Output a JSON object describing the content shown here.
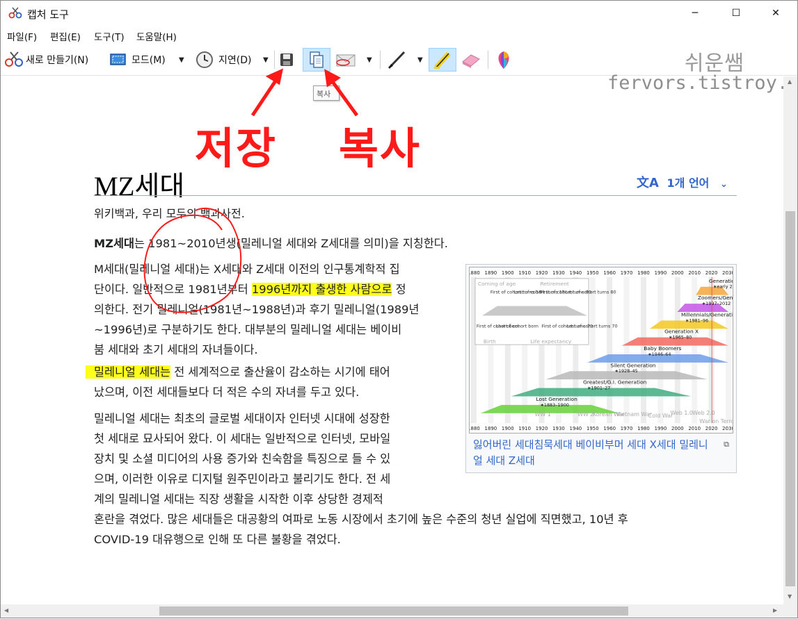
{
  "window": {
    "title": "캡처 도구",
    "controls": {
      "minimize": "─",
      "maximize": "☐",
      "close": "✕"
    }
  },
  "menu": [
    "파일(F)",
    "편집(E)",
    "도구(T)",
    "도움말(H)"
  ],
  "toolbar": {
    "new_label": "새로 만들기(N)",
    "mode_label": "모드(M)",
    "delay_label": "지연(D)",
    "tooltip": "복사",
    "watermark_ko": "쉬운쌤",
    "watermark_url": "fervors.tistroy.co"
  },
  "annotations": {
    "save": "저장",
    "copy": "복사"
  },
  "article": {
    "title": "MZ세대",
    "language_button": "1개 언어",
    "subtitle": "위키백과, 우리 모두의 백과사전.",
    "intro": {
      "bold": "MZ세대",
      "rest": "는 1981~2010년생(밀레니얼 세대와 Z세대를 의미)을 지칭한다."
    },
    "p1": [
      "M세대(밀레니얼 세대)는 X세대와 Z세대 이전의 인구통계학적 집",
      "단이다. 일반적으로 1981년부터 ",
      "1996년까지 출생한 사람으로",
      " 정",
      "의한다. 전기 밀레니얼(1981년~1988년)과 후기 밀레니얼(1989년",
      "~1996년)로 구분하기도 한다. 대부분의 밀레니얼 세대는 베이비",
      "붐 세대와 초기 세대의 자녀들이다."
    ],
    "p2": [
      "밀레니얼 세대는",
      " 전 세계적으로 출산율이 감소하는 시기에 태어",
      "났으며, 이전 세대들보다 더 적은 수의 자녀를 두고 있다."
    ],
    "p3": [
      "밀레니얼 세대는 최초의 글로벌 세대이자 인터넷 시대에 성장한",
      "첫 세대로 묘사되어 왔다. 이 세대는 일반적으로 인터넷, 모바일",
      "장치 및 소셜 미디어의 사용 증가와 친숙함을 특징으로 들 수 있",
      "으며, 이러한 이유로 디지털 원주민이라고 불리기도 한다. 전 세",
      "계의 밀레니얼 세대는 직장 생활을 시작한 이후 상당한 경제적",
      "혼란을 겪었다. 많은 세대들은 대공황의 여파로 노동 시장에서 초기에 높은 수준의 청년 실업에 직면했고, 10년 후",
      "COVID-19 대유행으로 인해 또 다른 불황을 겪었다."
    ],
    "caption": "잃어버린 세대침묵세대 베이비부머 세대 X세대 밀레니얼 세대 Z세대",
    "enlarge_icon": "⧉"
  },
  "chart": {
    "years": [
      "1880",
      "1890",
      "1900",
      "1910",
      "1920",
      "1930",
      "1940",
      "1950",
      "1960",
      "1970",
      "1980",
      "1990",
      "2000",
      "2010",
      "2020",
      "2030"
    ],
    "generations": [
      {
        "name": "Generation Alpha",
        "dates": "∗early 2010s – mid-2020s",
        "color": "#f4a63a"
      },
      {
        "name": "Zoomers/Generation Z",
        "dates": "∗1997–2012",
        "color": "#c455e8"
      },
      {
        "name": "Millennials/Generation Y",
        "dates": "∗1981–96",
        "color": "#f3c81e"
      },
      {
        "name": "Generation X",
        "dates": "∗1965–80",
        "color": "#f2695e"
      },
      {
        "name": "Baby Boomers",
        "dates": "∗1946–64",
        "color": "#6c9ee8"
      },
      {
        "name": "Silent Generation",
        "dates": "∗1928–45",
        "color": "#b8b8b8"
      },
      {
        "name": "Greatest/G.I. Generation",
        "dates": "∗1901–27",
        "color": "#3fae80"
      },
      {
        "name": "Lost Generation",
        "dates": "∗1883–1900",
        "color": "#67d13a"
      }
    ],
    "legend": {
      "coming_of_age": "Coming of age",
      "retirement": "Retirement",
      "first_cohort_18": "First of cohort turns 18",
      "last_cohort_18": "Last of cohort turns 18",
      "first_cohort_80": "First of cohort turns 80",
      "last_cohort_80": "Last of cohort turns 80",
      "first_cohort_born": "First of cohort born",
      "last_cohort_born": "Last of cohort born",
      "first_cohort_70": "First of cohort turns 70",
      "last_cohort_70": "Last of cohort turns 70",
      "birth": "Birth",
      "life_expectancy": "Life expectancy"
    },
    "events": [
      "WW 1",
      "WW 2",
      "Korean War",
      "Vietnam War",
      "Cold War",
      "Web 1.0",
      "Web 2.0",
      "War on Terror"
    ]
  }
}
